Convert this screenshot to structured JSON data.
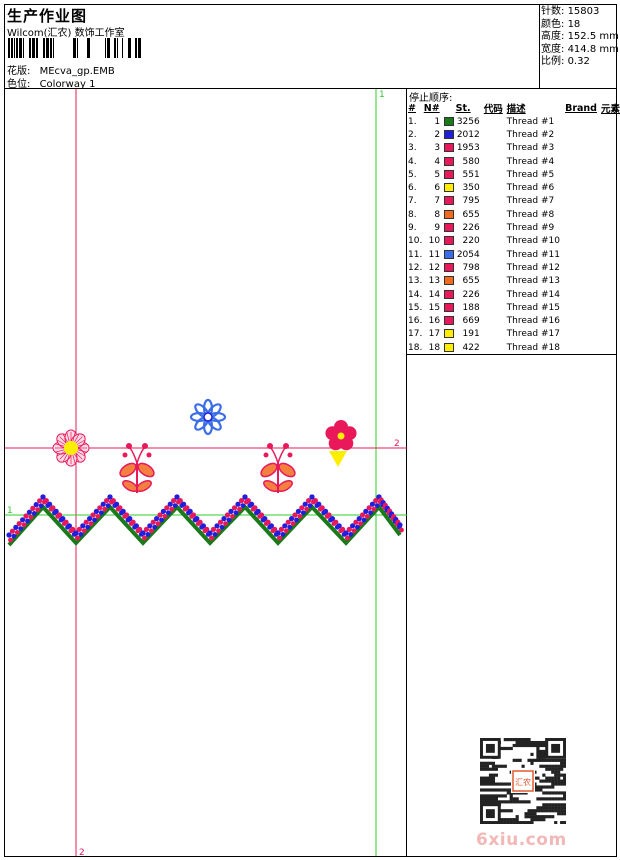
{
  "header": {
    "title": "生产作业图",
    "subtitle": "Wilcom(汇农) 数饰工作室",
    "design_label": "花版:",
    "design_value": "MEcva_gp.EMB",
    "colorway_label": "色位:",
    "colorway_value": "Colorway 1"
  },
  "specs": [
    {
      "label": "针数:",
      "value": "15803"
    },
    {
      "label": "颜色:",
      "value": "18"
    },
    {
      "label": "高度:",
      "value": "152.5 mm"
    },
    {
      "label": "宽度:",
      "value": "414.8 mm"
    },
    {
      "label": "比例:",
      "value": "0.32"
    }
  ],
  "threads_title": "停止顺序:",
  "thread_columns": [
    "#",
    "N#",
    "St.",
    "代码",
    "描述",
    "Brand",
    "元素"
  ],
  "threads": [
    {
      "idx": "1.",
      "n": "1",
      "color": "#1a7a1a",
      "st": "3256",
      "desc": "Thread #1"
    },
    {
      "idx": "2.",
      "n": "2",
      "color": "#1f1fdc",
      "st": "2012",
      "desc": "Thread #2"
    },
    {
      "idx": "3.",
      "n": "3",
      "color": "#e8185a",
      "st": "1953",
      "desc": "Thread #3"
    },
    {
      "idx": "4.",
      "n": "4",
      "color": "#e8185a",
      "st": "580",
      "desc": "Thread #4"
    },
    {
      "idx": "5.",
      "n": "5",
      "color": "#e8185a",
      "st": "551",
      "desc": "Thread #5"
    },
    {
      "idx": "6.",
      "n": "6",
      "color": "#ffee00",
      "st": "350",
      "desc": "Thread #6"
    },
    {
      "idx": "7.",
      "n": "7",
      "color": "#e8185a",
      "st": "795",
      "desc": "Thread #7"
    },
    {
      "idx": "8.",
      "n": "8",
      "color": "#f26a1e",
      "st": "655",
      "desc": "Thread #8"
    },
    {
      "idx": "9.",
      "n": "9",
      "color": "#e8185a",
      "st": "226",
      "desc": "Thread #9"
    },
    {
      "idx": "10.",
      "n": "10",
      "color": "#e8185a",
      "st": "220",
      "desc": "Thread #10"
    },
    {
      "idx": "11.",
      "n": "11",
      "color": "#3a6ee8",
      "st": "2054",
      "desc": "Thread #11"
    },
    {
      "idx": "12.",
      "n": "12",
      "color": "#e8185a",
      "st": "798",
      "desc": "Thread #12"
    },
    {
      "idx": "13.",
      "n": "13",
      "color": "#f26a1e",
      "st": "655",
      "desc": "Thread #13"
    },
    {
      "idx": "14.",
      "n": "14",
      "color": "#e8185a",
      "st": "226",
      "desc": "Thread #14"
    },
    {
      "idx": "15.",
      "n": "15",
      "color": "#e8185a",
      "st": "188",
      "desc": "Thread #15"
    },
    {
      "idx": "16.",
      "n": "16",
      "color": "#e8185a",
      "st": "669",
      "desc": "Thread #16"
    },
    {
      "idx": "17.",
      "n": "17",
      "color": "#ffee00",
      "st": "191",
      "desc": "Thread #17"
    },
    {
      "idx": "18.",
      "n": "18",
      "color": "#ffee00",
      "st": "422",
      "desc": "Thread #18"
    }
  ],
  "guides": {
    "v1": "1",
    "h2": "2",
    "h1": "1",
    "v2": "2"
  },
  "watermark": "6xiu.com",
  "qr_stamp": "汇农"
}
